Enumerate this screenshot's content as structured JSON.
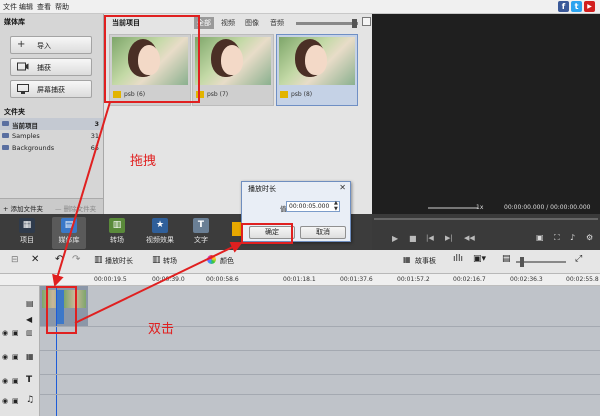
{
  "menu": {
    "items": [
      "文件",
      "编辑",
      "查看",
      "帮助"
    ]
  },
  "social": {
    "facebook": "f",
    "twitter": "t",
    "youtube": "▶"
  },
  "library": {
    "title": "媒体库",
    "buttons": [
      {
        "label": "导入",
        "icon": "plus-icon"
      },
      {
        "label": "捕获",
        "icon": "camera-icon"
      },
      {
        "label": "屏幕捕获",
        "icon": "monitor-icon"
      }
    ],
    "folders_title": "文件夹",
    "folders": [
      {
        "name": "当前项目",
        "count": "3"
      },
      {
        "name": "Samples",
        "count": "31"
      },
      {
        "name": "Backgrounds",
        "count": "65"
      }
    ],
    "add_folder": "添加文件夹",
    "delete_folder": "删除文件夹"
  },
  "media": {
    "title": "当前项目",
    "tabs": [
      "全部",
      "视频",
      "图像",
      "音频"
    ],
    "items": [
      {
        "caption": "psb (6)"
      },
      {
        "caption": "psb (7)"
      },
      {
        "caption": "psb (8)"
      }
    ]
  },
  "toolbar": {
    "items": [
      {
        "label": "项目",
        "color": "#2f3b4c"
      },
      {
        "label": "媒体库",
        "color": "#3a78c8"
      },
      {
        "label": "转场",
        "color": "#5a8a3a"
      },
      {
        "label": "视频效果",
        "color": "#2f5f9a"
      },
      {
        "label": "文字",
        "color": "#6a7f95"
      }
    ]
  },
  "preview": {
    "speed": "1x",
    "time": "00:00:00.000 / 00:00:00.000"
  },
  "timeline": {
    "actions": [
      "播放时长",
      "转场",
      "颜色"
    ],
    "storyboard": "故事板",
    "ticks": [
      "00:00:19.5",
      "00:00:39.0",
      "00:00:58.6",
      "00:01:18.1",
      "00:01:37.6",
      "00:01:57.2",
      "00:02:16.7",
      "00:02:36.3",
      "00:02:55.8"
    ]
  },
  "dialog": {
    "title": "播放时长",
    "value_label": "值:",
    "value": "00:00:05.000",
    "ok": "确定",
    "cancel": "取消"
  },
  "annotations": {
    "drag": "拖拽",
    "double_click": "双击"
  },
  "colors": {
    "accent": "#e02020",
    "preview_bg": "#1f1f1f",
    "toolbar_bg": "#3c3c3c"
  }
}
